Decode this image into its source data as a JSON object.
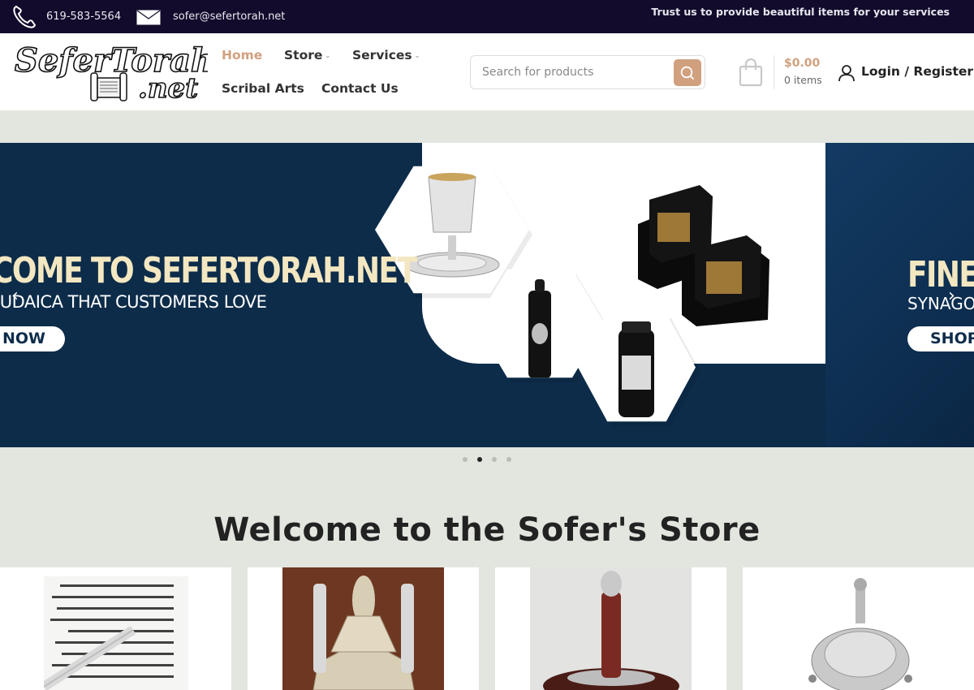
{
  "topbar": {
    "phone": "619-583-5564",
    "email": "sofer@sefertorah.net",
    "trust_text": "Trust us to provide beautiful items for your services"
  },
  "header": {
    "logo_text": [
      "SeferTorah",
      ".net"
    ],
    "nav": {
      "home": "Home",
      "store": "Store",
      "services": "Services",
      "scribal_arts": "Scribal Arts",
      "contact": "Contact Us"
    },
    "search": {
      "placeholder": "Search for products",
      "value": ""
    },
    "cart": {
      "total": "$0.00",
      "count": "0 items"
    },
    "login": "Login / Register"
  },
  "slider": {
    "slide1": {
      "headline": "COME TO SEFERTORAH.NET",
      "subline": "JUDAICA THAT CUSTOMERS LOVE",
      "button": "NOW"
    },
    "slide2": {
      "headline": "FINE A",
      "subline": "SYNAGO",
      "button": "SHOP"
    },
    "arrows": {
      "prev": "‹",
      "next": "›"
    },
    "dots_count": 4,
    "active_dot": 2
  },
  "welcome": "Welcome to the Sofer's Store",
  "colors": {
    "topbar": "#130b2c",
    "accent": "#d1a07e",
    "page_bg": "#e2e6df",
    "slide_bg": "#0d2c4a",
    "headline": "#f3e7c1"
  },
  "icons": {
    "phone": "phone-icon",
    "mail": "mail-icon",
    "search": "search-icon",
    "cart": "shopping-bag-icon",
    "user": "user-icon"
  }
}
